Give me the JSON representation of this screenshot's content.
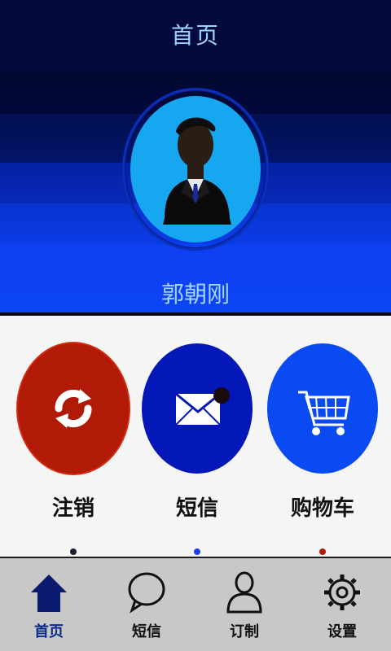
{
  "header": {
    "title": "首页",
    "username": "郭朝刚"
  },
  "actions": [
    {
      "label": "注销",
      "icon": "refresh-icon",
      "color": "#b01a06"
    },
    {
      "label": "短信",
      "icon": "envelope-icon",
      "color": "#0417b8"
    },
    {
      "label": "购物车",
      "icon": "shopping-cart-icon",
      "color": "#0a4af3"
    }
  ],
  "tabs": [
    {
      "label": "首页",
      "icon": "home-icon",
      "active": true
    },
    {
      "label": "短信",
      "icon": "speech-bubble-icon",
      "active": false
    },
    {
      "label": "订制",
      "icon": "person-icon",
      "active": false
    },
    {
      "label": "设置",
      "icon": "gear-icon",
      "active": false
    }
  ]
}
